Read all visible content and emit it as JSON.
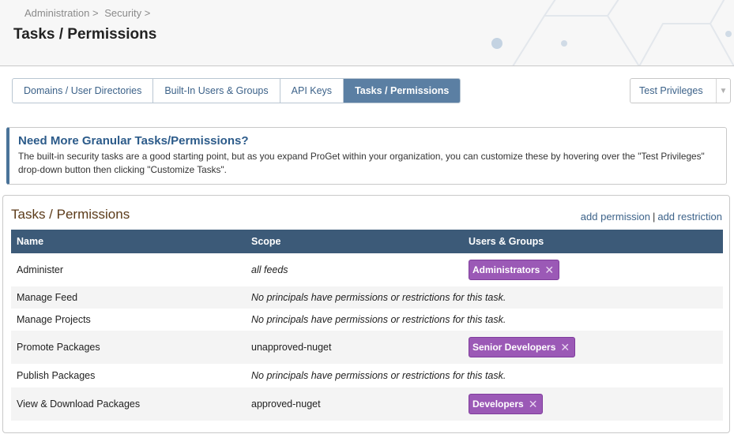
{
  "breadcrumb": [
    "Administration >",
    "Security >"
  ],
  "page_title": "Tasks / Permissions",
  "tabs": [
    {
      "label": "Domains / User Directories"
    },
    {
      "label": "Built-In Users & Groups"
    },
    {
      "label": "API Keys"
    },
    {
      "label": "Tasks / Permissions"
    }
  ],
  "privileges_button": {
    "label": "Test Privileges",
    "caret": "▼"
  },
  "info": {
    "title": "Need More Granular Tasks/Permissions?",
    "text": "The built-in security tasks are a good starting point, but as you expand ProGet within your organization, you can customize these by hovering over the \"Test Privileges\" drop-down button then clicking \"Customize Tasks\"."
  },
  "panel": {
    "title": "Tasks / Permissions",
    "add_permission": "add permission",
    "separator": "|",
    "add_restriction": "add restriction"
  },
  "table": {
    "headers": [
      "Name",
      "Scope",
      "Users & Groups"
    ],
    "rows": [
      {
        "name": "Administer",
        "scope": "all feeds",
        "chip": "Administrators"
      },
      {
        "name": "Manage Feed",
        "scope": "No principals have permissions or restrictions for this task."
      },
      {
        "name": "Manage Projects",
        "scope": "No principals have permissions or restrictions for this task."
      },
      {
        "name": "Promote Packages",
        "scope": "unapproved-nuget",
        "chip": "Senior Developers"
      },
      {
        "name": "Publish Packages",
        "scope": "No principals have permissions or restrictions for this task."
      },
      {
        "name": "View & Download Packages",
        "scope": "approved-nuget",
        "chip": "Developers"
      }
    ],
    "remove_glyph": "✕"
  },
  "colors": {
    "accent": "#5b7fa3",
    "table_header": "#3c5a78",
    "chip": "#9b59b6",
    "panel_title": "#5b3a18"
  }
}
